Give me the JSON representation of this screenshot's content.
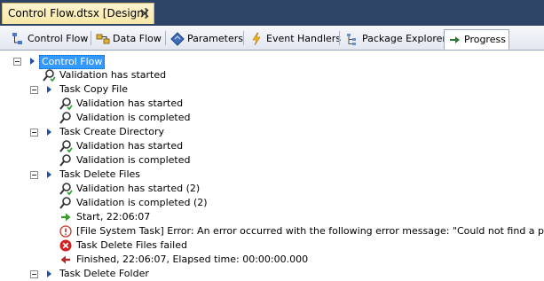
{
  "document_tab": {
    "title": "Control Flow.dtsx [Design]",
    "close_glyph": "×"
  },
  "designer_tabs": [
    {
      "label": "Control Flow",
      "icon": "control-flow-icon"
    },
    {
      "label": "Data Flow",
      "icon": "data-flow-icon"
    },
    {
      "label": "Parameters",
      "icon": "parameters-icon"
    },
    {
      "label": "Event Handlers",
      "icon": "event-handlers-icon"
    },
    {
      "label": "Package Explorer",
      "icon": "package-explorer-icon"
    },
    {
      "label": "Progress",
      "icon": "progress-icon",
      "active": true
    }
  ],
  "progress": {
    "root": "Control Flow",
    "root_validation": "Validation has started",
    "tasks": [
      {
        "name": "Task Copy File",
        "messages": [
          "Validation has started",
          "Validation is completed"
        ]
      },
      {
        "name": "Task Create Directory",
        "messages": [
          "Validation has started",
          "Validation is completed"
        ]
      },
      {
        "name": "Task Delete Files",
        "messages": [
          "Validation has started (2)",
          "Validation is completed (2)",
          "Start, 22:06:07",
          "[File System Task] Error: An error occurred with the following error message: \"Could not find a part of the pat",
          "Task Delete Files failed",
          "Finished, 22:06:07, Elapsed time: 00:00:00.000"
        ]
      },
      {
        "name": "Task Delete Folder",
        "messages": []
      }
    ]
  },
  "colors": {
    "doc_strip": "#2e4466",
    "selection": "#3399ff",
    "arrow_blue": "#1f4fa8",
    "start_green": "#3a9a2a",
    "error_red": "#d32020",
    "finish_red": "#b02a2a"
  }
}
